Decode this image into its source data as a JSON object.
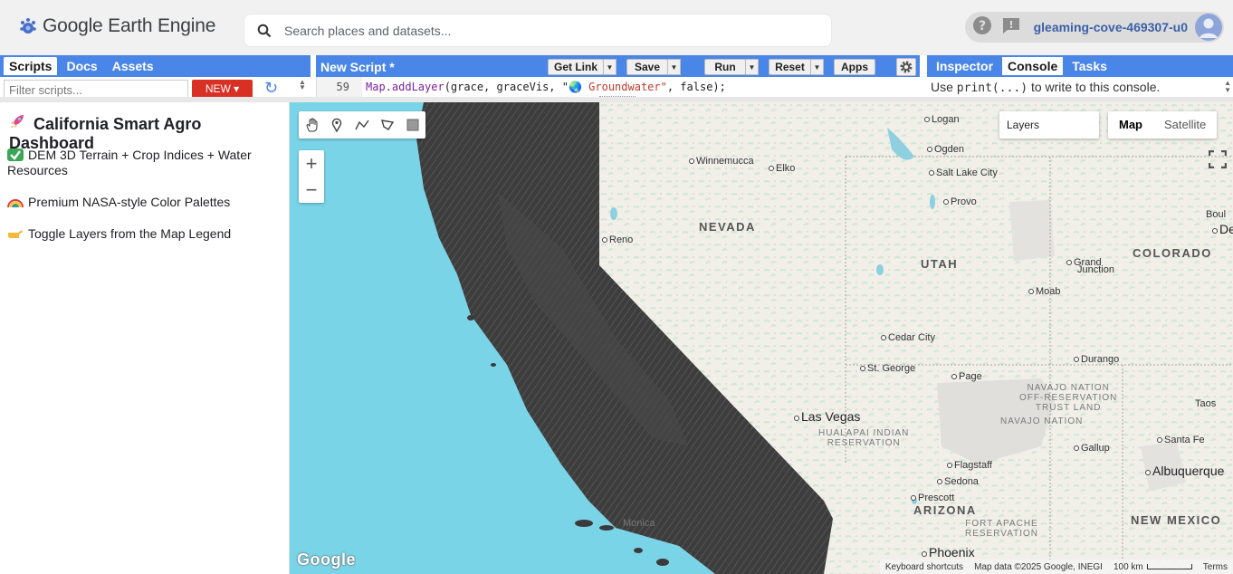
{
  "app": {
    "name": "Google Earth Engine",
    "search_placeholder": "Search places and datasets...",
    "project": "gleaming-cove-469307-u0"
  },
  "left_panel": {
    "tabs": [
      "Scripts",
      "Docs",
      "Assets"
    ],
    "active_tab": "Scripts",
    "filter_placeholder": "Filter scripts...",
    "new_label": "NEW"
  },
  "editor": {
    "title": "New Script *",
    "buttons": {
      "get_link": "Get Link",
      "save": "Save",
      "run": "Run",
      "reset": "Reset",
      "apps": "Apps"
    },
    "line_number": "59",
    "code": {
      "fn": "Map.addLayer",
      "args_pre": "(grace, graceVis, \"",
      "str": "🌏 Groundwater\"",
      "args_post": ", false);"
    }
  },
  "right_panel": {
    "tabs": [
      "Inspector",
      "Console",
      "Tasks"
    ],
    "active_tab": "Console",
    "console_pre": "Use ",
    "console_code": "print(...)",
    "console_post": " to write to this console."
  },
  "dashboard": {
    "title": "California Smart Agro Dashboard",
    "lines": [
      "DEM 3D Terrain + Crop Indices + Water Resources",
      "Premium NASA-style Color Palettes",
      "Toggle Layers from the Map Legend"
    ]
  },
  "map": {
    "layers_label": "Layers",
    "map_types": [
      "Map",
      "Satellite"
    ],
    "selected_map_type": "Map",
    "attribution": {
      "shortcuts": "Keyboard shortcuts",
      "data": "Map data ©2025 Google, INEGI",
      "scale": "100 km",
      "terms": "Terms"
    },
    "google_logo": "Google",
    "labels": {
      "logan": "Logan",
      "ogden": "Ogden",
      "salt_lake": "Salt Lake City",
      "provo": "Provo",
      "winnemucca": "Winnemucca",
      "elko": "Elko",
      "nevada": "NEVADA",
      "reno": "Reno",
      "utah": "UTAH",
      "grand_junction_1": "Grand",
      "grand_junction_2": "Junction",
      "moab": "Moab",
      "colorado": "COLORADO",
      "boul": "Boul",
      "de": "De",
      "cedar_city": "Cedar City",
      "st_george": "St. George",
      "durango": "Durango",
      "page": "Page",
      "navajo_trust": "NAVAJO NATION\nOFF-RESERVATION\nTRUST LAND",
      "navajo_nation": "NAVAJO NATION",
      "las_vegas": "Las Vegas",
      "taos": "Taos",
      "hualapai": "HUALAPAI INDIAN\nRESERVATION",
      "gallup": "Gallup",
      "santa_fe": "Santa Fe",
      "albuquerque": "Albuquerque",
      "flagstaff": "Flagstaff",
      "sedona": "Sedona",
      "prescott": "Prescott",
      "arizona": "ARIZONA",
      "new_mexico": "NEW MEXICO",
      "fort_apache": "FORT APACHE\nRESERVATION",
      "phoenix": "Phoenix",
      "monica": "Monica"
    }
  },
  "colors": {
    "accent": "#4a86e8",
    "new_button": "#d93025",
    "ocean": "#7ad4e8",
    "terrain": "#3a3a3a"
  }
}
